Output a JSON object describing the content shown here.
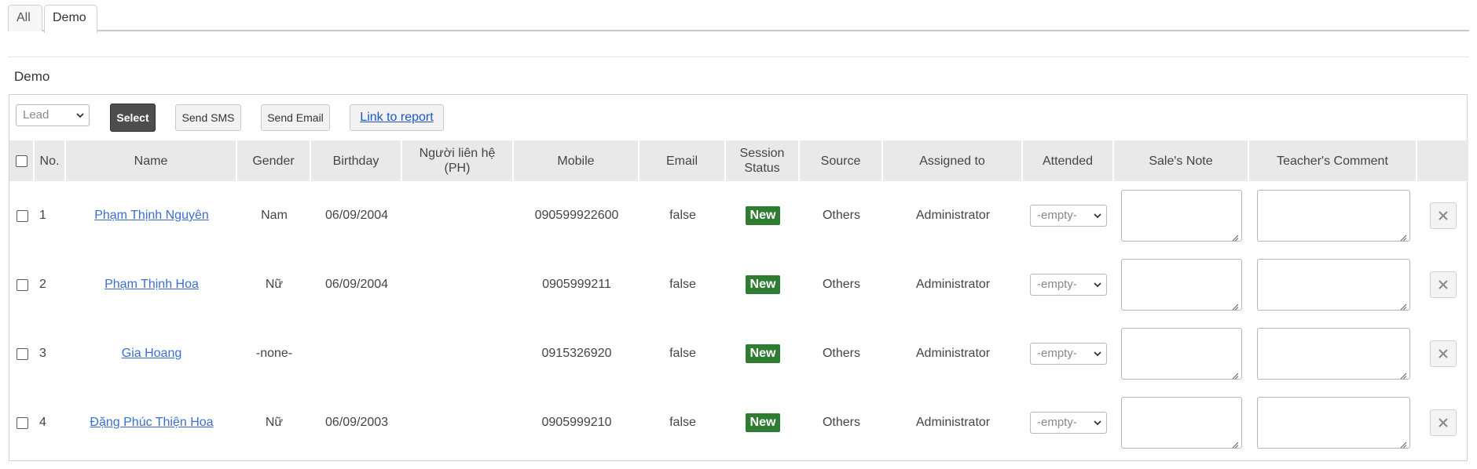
{
  "tabs": [
    {
      "label": "All"
    },
    {
      "label": "Demo"
    }
  ],
  "section_title": "Demo",
  "toolbar": {
    "status_select_value": "Lead",
    "select_label": "Select",
    "send_sms_label": "Send SMS",
    "send_email_label": "Send Email",
    "report_link_label": "Link to report"
  },
  "columns": {
    "no": "No.",
    "name": "Name",
    "gender": "Gender",
    "birthday": "Birthday",
    "contact": "Người liên hệ (PH)",
    "mobile": "Mobile",
    "email": "Email",
    "session_status": "Session Status",
    "source": "Source",
    "assigned_to": "Assigned to",
    "attended": "Attended",
    "sales_note": "Sale's Note",
    "teacher_comment": "Teacher's Comment"
  },
  "rows": [
    {
      "no": "1",
      "name": "Phạm Thịnh Nguyên",
      "gender": "Nam",
      "birthday": "06/09/2004",
      "contact": "",
      "mobile": "090599922600",
      "email": "false",
      "status": "New",
      "source": "Others",
      "assigned_to": "Administrator",
      "attended": "-empty-"
    },
    {
      "no": "2",
      "name": "Phạm Thịnh Hoa",
      "gender": "Nữ",
      "birthday": "06/09/2004",
      "contact": "",
      "mobile": "0905999211",
      "email": "false",
      "status": "New",
      "source": "Others",
      "assigned_to": "Administrator",
      "attended": "-empty-"
    },
    {
      "no": "3",
      "name": "Gia Hoang",
      "gender": "-none-",
      "birthday": "",
      "contact": "",
      "mobile": "0915326920",
      "email": "false",
      "status": "New",
      "source": "Others",
      "assigned_to": "Administrator",
      "attended": "-empty-"
    },
    {
      "no": "4",
      "name": "Đặng Phúc Thiện Hoa",
      "gender": "Nữ",
      "birthday": "06/09/2003",
      "contact": "",
      "mobile": "0905999210",
      "email": "false",
      "status": "New",
      "source": "Others",
      "assigned_to": "Administrator",
      "attended": "-empty-"
    }
  ],
  "colors": {
    "badge_new": "#2f7d32",
    "link": "#3a6fcf",
    "select_button": "#4d4d4d"
  },
  "icons": {
    "dropdown": "chevron-down-icon",
    "delete": "close-icon",
    "resize": "resize-grip-icon"
  }
}
